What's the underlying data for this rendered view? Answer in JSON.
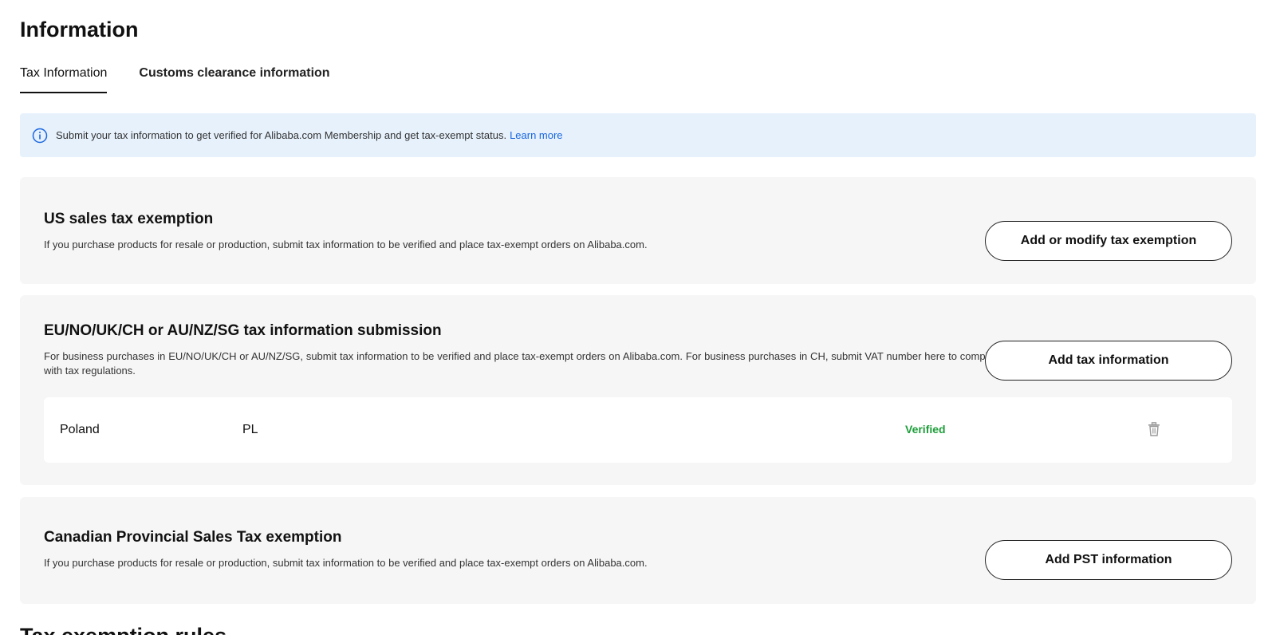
{
  "page": {
    "title": "Information"
  },
  "tabs": [
    {
      "label": "Tax Information",
      "active": true
    },
    {
      "label": "Customs clearance information",
      "active": false
    }
  ],
  "banner": {
    "icon": "info-icon",
    "text": "Submit your tax information to get verified for Alibaba.com Membership and get tax-exempt status.",
    "link": "Learn more"
  },
  "cards": {
    "us": {
      "title": "US sales tax exemption",
      "description": "If you purchase products for resale or production, submit tax information to be verified and place tax-exempt orders on Alibaba.com.",
      "button": "Add or modify tax exemption"
    },
    "eu": {
      "title": "EU/NO/UK/CH or AU/NZ/SG tax information submission",
      "description": "For business purchases in EU/NO/UK/CH or AU/NZ/SG, submit tax information to be verified and place tax-exempt orders on Alibaba.com. For business purchases in CH, submit VAT number here to comply with tax regulations.",
      "button": "Add tax information",
      "rows": [
        {
          "country": "Poland",
          "code": "PL",
          "status": "Verified",
          "action_icon": "trash-icon"
        }
      ]
    },
    "ca": {
      "title": "Canadian Provincial Sales Tax exemption",
      "description": "If you purchase products for resale or production, submit tax information to be verified and place tax-exempt orders on Alibaba.com.",
      "button": "Add PST information"
    }
  },
  "next_section": {
    "title": "Tax exemption rules"
  },
  "colors": {
    "accent": "#1a66e0",
    "banner_bg": "#e6f1fc",
    "card_bg": "#f6f6f6",
    "verified": "#1e9e3a"
  }
}
